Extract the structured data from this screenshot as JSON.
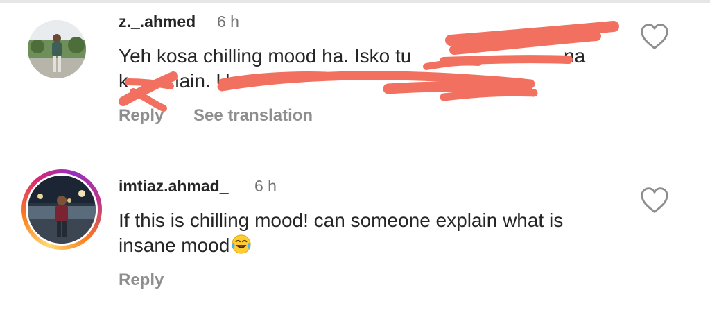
{
  "comments": [
    {
      "username": "z._.ahmed",
      "time": "6 h",
      "text_line1": "Yeh kosa chilling mood ha. Isko tu",
      "text_line1_tail": "na",
      "text_line2": "k",
      "text_line2_mid": "hain. U",
      "avatar_icon": "profile-photo",
      "actions": {
        "reply": "Reply",
        "translate": "See translation"
      },
      "redacted": true,
      "scribble_color": "#f2705f"
    },
    {
      "username": "imtiaz.ahmad_",
      "time": "6 h",
      "text": "If this is chilling mood! can someone explain what is insane mood",
      "emoji": "face-with-tears-of-joy",
      "avatar_icon": "profile-photo-story-ring",
      "actions": {
        "reply": "Reply"
      }
    }
  ],
  "icons": {
    "like": "heart-outline-icon"
  },
  "colors": {
    "username": "#262626",
    "meta": "#737373",
    "action": "#8e8e8e",
    "heart": "#8e8e8e"
  }
}
